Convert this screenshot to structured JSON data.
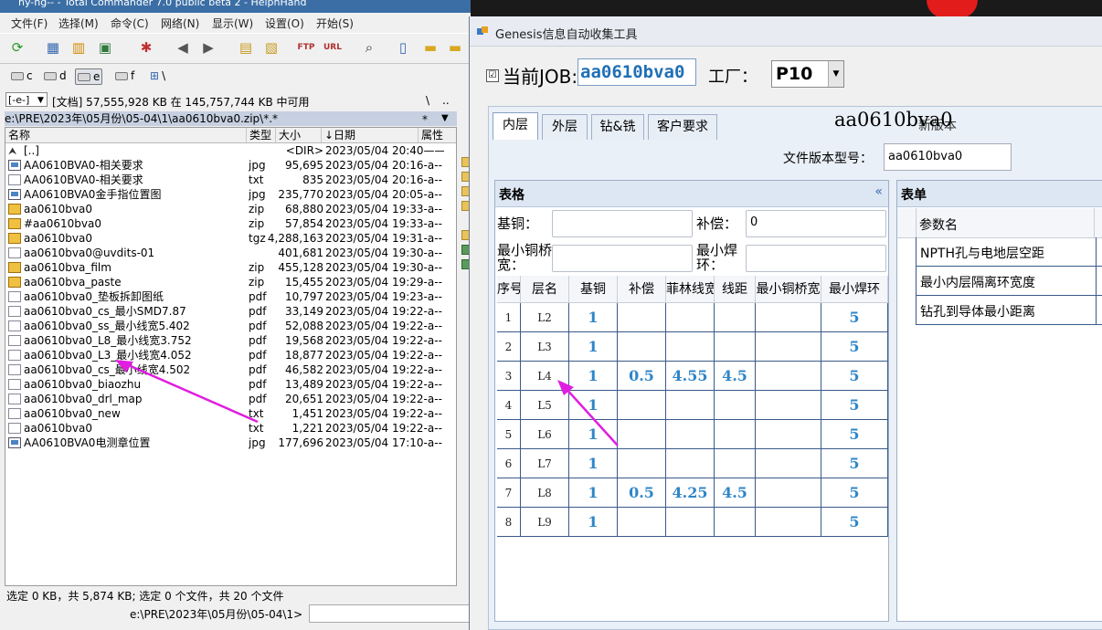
{
  "total_commander": {
    "title": "ny-ng-- - Total Commander 7.0 public beta 2 - HelphHand",
    "menu": [
      "文件(F)",
      "选择(M)",
      "命令(C)",
      "网络(N)",
      "显示(W)",
      "设置(O)",
      "开始(S)"
    ],
    "toolbar_icons": [
      "refresh-icon",
      "brief-view-icon",
      "full-view-icon",
      "thumbnail-view-icon",
      "invert-selection-icon",
      "back-icon",
      "forward-icon",
      "pack-icon",
      "unpack-icon",
      "ftp-icon",
      "url-icon",
      "find-icon",
      "notepad-icon",
      "folder-icon",
      "folder-icon"
    ],
    "drives": [
      {
        "letter": "c",
        "selected": false
      },
      {
        "letter": "d",
        "selected": false
      },
      {
        "letter": "e",
        "selected": true
      },
      {
        "letter": "f",
        "selected": false
      }
    ],
    "network_drive": "\\",
    "drive_select": "[-e-]",
    "free_space": "[文档]  57,555,928 KB 在 145,757,744 KB 中可用",
    "nav_up": "\\",
    "nav_dots": "..",
    "path": "e:\\PRE\\2023年\\05月份\\05-04\\1\\aa0610bva0.zip\\*.*",
    "path_star": "*",
    "path_arrow": "▼",
    "columns": {
      "name": "名称",
      "ext": "类型",
      "size": "大小",
      "date": "↓日期",
      "attr": "属性"
    },
    "files": [
      {
        "icon": "up",
        "name": "[..]",
        "ext": "",
        "size": "<DIR>",
        "date": "2023/05/04 20:40——"
      },
      {
        "icon": "img",
        "name": "AA0610BVA0-相关要求",
        "ext": "jpg",
        "size": "95,695",
        "date": "2023/05/04 20:16-a--"
      },
      {
        "icon": "txt",
        "name": "AA0610BVA0-相关要求",
        "ext": "txt",
        "size": "835",
        "date": "2023/05/04 20:16-a--"
      },
      {
        "icon": "img",
        "name": "AA0610BVA0金手指位置图",
        "ext": "jpg",
        "size": "235,770",
        "date": "2023/05/04 20:05-a--"
      },
      {
        "icon": "zip",
        "name": "aa0610bva0",
        "ext": "zip",
        "size": "68,880",
        "date": "2023/05/04 19:33-a--"
      },
      {
        "icon": "zip",
        "name": "#aa0610bva0",
        "ext": "zip",
        "size": "57,854",
        "date": "2023/05/04 19:33-a--"
      },
      {
        "icon": "zip",
        "name": "aa0610bva0",
        "ext": "tgz",
        "size": "4,288,163",
        "date": "2023/05/04 19:31-a--"
      },
      {
        "icon": "txt",
        "name": "aa0610bva0@uvdits-01",
        "ext": "",
        "size": "401,681",
        "date": "2023/05/04 19:30-a--"
      },
      {
        "icon": "zip",
        "name": "aa0610bva_film",
        "ext": "zip",
        "size": "455,128",
        "date": "2023/05/04 19:30-a--"
      },
      {
        "icon": "zip",
        "name": "aa0610bva_paste",
        "ext": "zip",
        "size": "15,455",
        "date": "2023/05/04 19:29-a--"
      },
      {
        "icon": "pdf",
        "name": "aa0610bva0_垫板拆卸图纸",
        "ext": "pdf",
        "size": "10,797",
        "date": "2023/05/04 19:23-a--"
      },
      {
        "icon": "pdf",
        "name": "aa0610bva0_cs_最小SMD7.87",
        "ext": "pdf",
        "size": "33,149",
        "date": "2023/05/04 19:22-a--"
      },
      {
        "icon": "pdf",
        "name": "aa0610bva0_ss_最小线宽5.402",
        "ext": "pdf",
        "size": "52,088",
        "date": "2023/05/04 19:22-a--"
      },
      {
        "icon": "pdf",
        "name": "aa0610bva0_L8_最小线宽3.752",
        "ext": "pdf",
        "size": "19,568",
        "date": "2023/05/04 19:22-a--"
      },
      {
        "icon": "pdf",
        "name": "aa0610bva0_L3_最小线宽4.052",
        "ext": "pdf",
        "size": "18,877",
        "date": "2023/05/04 19:22-a--"
      },
      {
        "icon": "pdf",
        "name": "aa0610bva0_cs_最小线宽4.502",
        "ext": "pdf",
        "size": "46,582",
        "date": "2023/05/04 19:22-a--"
      },
      {
        "icon": "pdf",
        "name": "aa0610bva0_biaozhu",
        "ext": "pdf",
        "size": "13,489",
        "date": "2023/05/04 19:22-a--"
      },
      {
        "icon": "pdf",
        "name": "aa0610bva0_drl_map",
        "ext": "pdf",
        "size": "20,651",
        "date": "2023/05/04 19:22-a--"
      },
      {
        "icon": "txt",
        "name": "aa0610bva0_new",
        "ext": "txt",
        "size": "1,451",
        "date": "2023/05/04 19:22-a--"
      },
      {
        "icon": "txt",
        "name": "aa0610bva0",
        "ext": "txt",
        "size": "1,221",
        "date": "2023/05/04 19:22-a--"
      },
      {
        "icon": "img",
        "name": "AA0610BVA0电测章位置",
        "ext": "jpg",
        "size": "177,696",
        "date": "2023/05/04 17:10-a--"
      }
    ],
    "status": "选定 0 KB，共 5,874 KB; 选定 0 个文件，共 20 个文件",
    "cmd_path": "e:\\PRE\\2023年\\05月份\\05-04\\1>"
  },
  "genesis": {
    "title": "Genesis信息自动收集工具",
    "job_checked": "☑",
    "job_label": "当前JOB:",
    "job_value": "aa0610bva0",
    "factory_label": "工厂：",
    "factory_value": "P10",
    "tabs": [
      "内层",
      "外层",
      "钻&铣",
      "客户要求"
    ],
    "active_tab": "内层",
    "job_name_display": "aa0610bva0",
    "new_version_hint": "新版本",
    "version_label": "文件版本型号：",
    "version_value": "aa0610bva0",
    "table_group_title": "表格",
    "collapse_glyph": "«",
    "base_copper_label": "基铜：",
    "base_copper_value": "",
    "compensation_label": "补偿：",
    "compensation_value": "0",
    "min_copper_bridge_label": "最小铜桥宽：",
    "min_copper_bridge_value": "",
    "min_annular_ring_label": "最小焊环：",
    "min_annular_ring_value": "",
    "grid_columns": [
      "序号",
      "层名",
      "基铜",
      "补偿",
      "菲林线宽",
      "线距",
      "最小铜桥宽",
      "最小焊环"
    ],
    "grid_rows": [
      [
        "1",
        "L2",
        "1",
        "",
        "",
        "",
        "",
        "5"
      ],
      [
        "2",
        "L3",
        "1",
        "",
        "",
        "",
        "",
        "5"
      ],
      [
        "3",
        "L4",
        "1",
        "0.5",
        "4.55",
        "4.5",
        "",
        "5"
      ],
      [
        "4",
        "L5",
        "1",
        "",
        "",
        "",
        "",
        "5"
      ],
      [
        "5",
        "L6",
        "1",
        "",
        "",
        "",
        "",
        "5"
      ],
      [
        "6",
        "L7",
        "1",
        "",
        "",
        "",
        "",
        "5"
      ],
      [
        "7",
        "L8",
        "1",
        "0.5",
        "4.25",
        "4.5",
        "",
        "5"
      ],
      [
        "8",
        "L9",
        "1",
        "",
        "",
        "",
        "",
        "5"
      ]
    ],
    "form_group_title": "表单",
    "param_header": "参数名",
    "params": [
      "NPTH孔与电地层空距",
      "最小内层隔离环宽度",
      "钻孔到导体最小距离"
    ]
  },
  "colors": {
    "grid_value": "#2f86c8",
    "annotation_arrow": "#e01ee0",
    "path_bar": "#c6d0e1",
    "title_bar": "#3b6ea5"
  }
}
